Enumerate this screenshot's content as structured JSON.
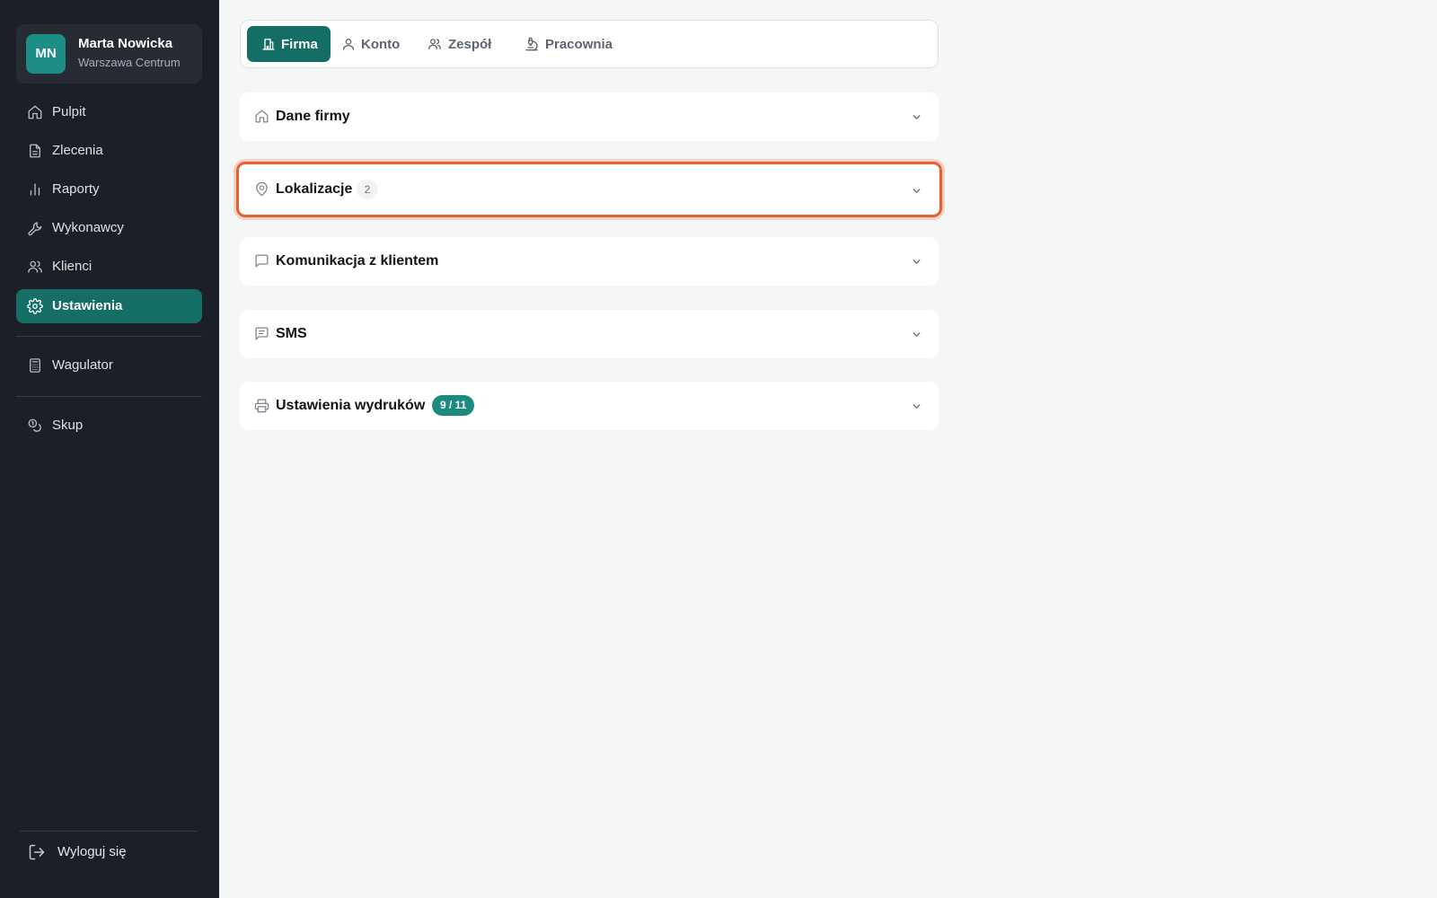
{
  "user": {
    "initials": "MN",
    "name": "Marta Nowicka",
    "location": "Warszawa Centrum"
  },
  "sidebar": {
    "items": [
      {
        "label": "Pulpit",
        "icon": "home-icon"
      },
      {
        "label": "Zlecenia",
        "icon": "document-icon"
      },
      {
        "label": "Raporty",
        "icon": "bar-chart-icon"
      },
      {
        "label": "Wykonawcy",
        "icon": "wrench-icon"
      },
      {
        "label": "Klienci",
        "icon": "users-icon"
      },
      {
        "label": "Ustawienia",
        "icon": "gear-icon",
        "active": true
      }
    ],
    "tools": [
      {
        "label": "Wagulator",
        "icon": "calculator-icon"
      },
      {
        "label": "Skup",
        "icon": "coins-icon"
      }
    ],
    "logout_label": "Wyloguj się"
  },
  "tabs": [
    {
      "label": "Firma",
      "icon": "building-icon",
      "active": true
    },
    {
      "label": "Konto",
      "icon": "user-icon"
    },
    {
      "label": "Zespół",
      "icon": "users-icon"
    },
    {
      "label": "Pracownia",
      "icon": "microscope-icon"
    }
  ],
  "sections": [
    {
      "title": "Dane firmy",
      "icon": "home-icon"
    },
    {
      "title": "Lokalizacje",
      "icon": "map-pin-icon",
      "count": "2",
      "highlighted": true
    },
    {
      "title": "Komunikacja z klientem",
      "icon": "chat-bubble-icon"
    },
    {
      "title": "SMS",
      "icon": "message-square-icon"
    },
    {
      "title": "Ustawienia wydruków",
      "icon": "printer-icon",
      "badge": "9 / 11"
    }
  ],
  "colors": {
    "sidebar_bg": "#1b1f27",
    "accent": "#146e66",
    "badge": "#1b8a80",
    "highlight_border": "#e8602d",
    "page_bg": "#f5f6f6"
  }
}
